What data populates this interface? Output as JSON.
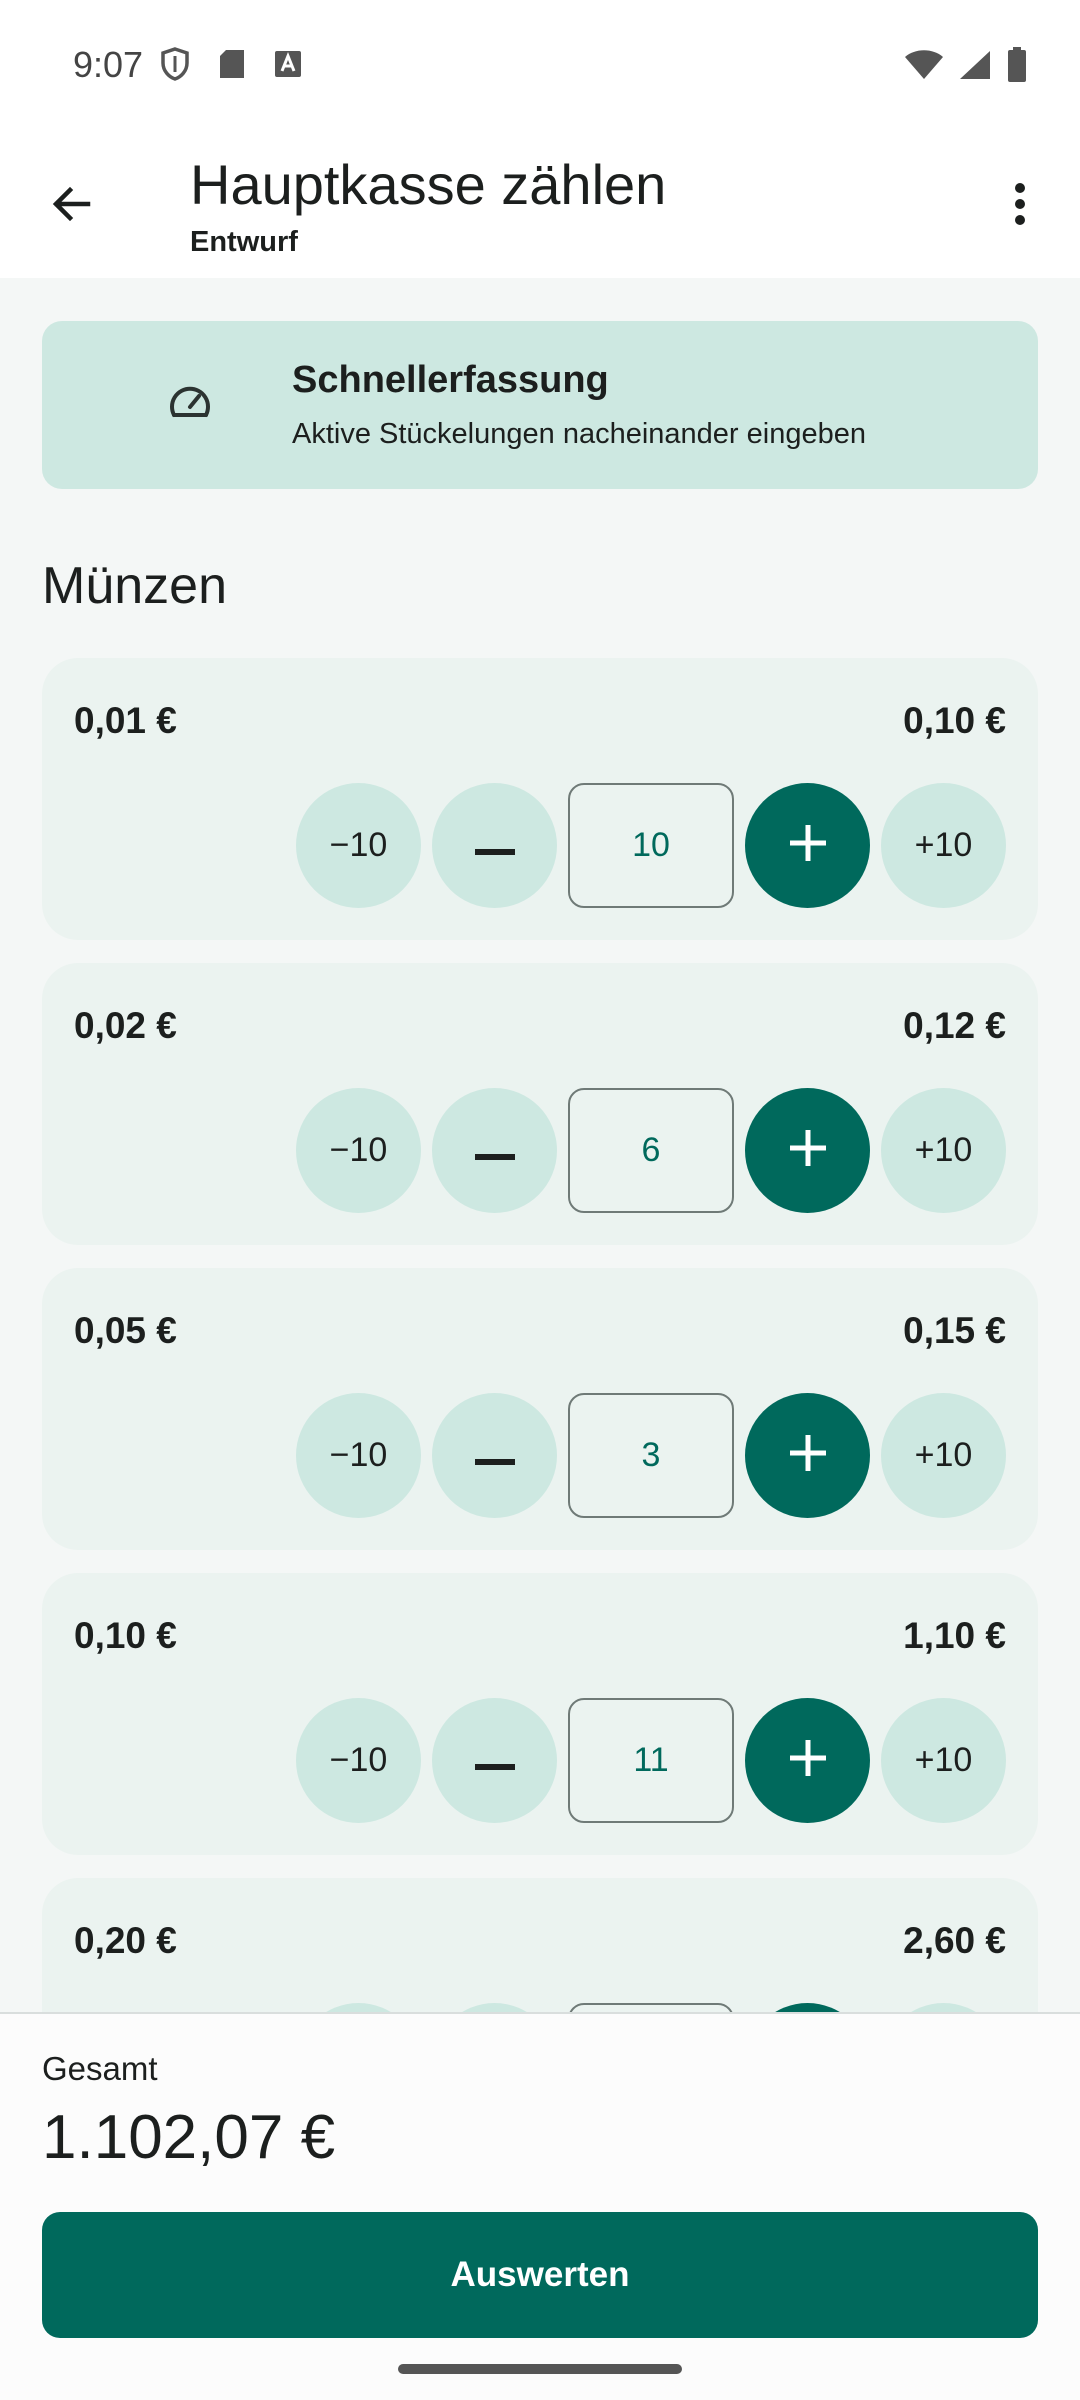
{
  "status_bar": {
    "time": "9:07"
  },
  "top_bar": {
    "title": "Hauptkasse zählen",
    "subtitle": "Entwurf"
  },
  "quick_entry": {
    "title": "Schnellerfassung",
    "description": "Aktive Stückelungen nacheinander eingeben"
  },
  "section": {
    "title": "Münzen"
  },
  "controls": {
    "minus_ten": "−10",
    "plus_ten": "+10"
  },
  "denominations": [
    {
      "label": "0,01 €",
      "total": "0,10 €",
      "count": "10"
    },
    {
      "label": "0,02 €",
      "total": "0,12 €",
      "count": "6"
    },
    {
      "label": "0,05 €",
      "total": "0,15 €",
      "count": "3"
    },
    {
      "label": "0,10 €",
      "total": "1,10 €",
      "count": "11"
    },
    {
      "label": "0,20 €",
      "total": "2,60 €",
      "count": ""
    }
  ],
  "summary": {
    "label": "Gesamt",
    "value": "1.102,07 €",
    "button": "Auswerten"
  },
  "colors": {
    "primary": "#00695c",
    "tonal": "#cde8e1",
    "card": "#ebf3f0"
  }
}
